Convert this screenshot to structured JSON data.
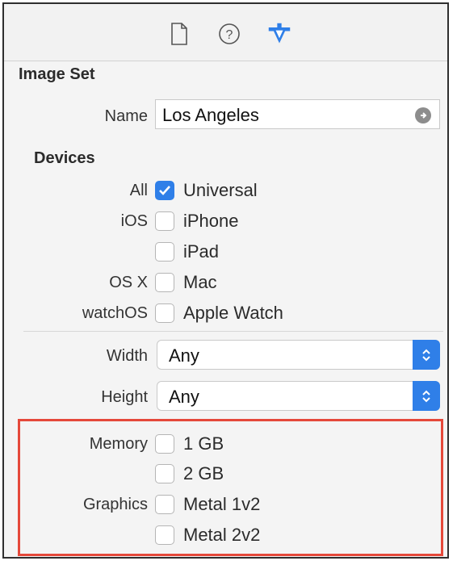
{
  "toolbar": {
    "icons": [
      "file-inspector-icon",
      "quick-help-icon",
      "attributes-inspector-icon"
    ],
    "active_color": "#2f7fe8"
  },
  "image_set": {
    "title": "Image Set",
    "name_label": "Name",
    "name_value": "Los Angeles"
  },
  "devices": {
    "title": "Devices",
    "rows": [
      {
        "label": "All",
        "option": "Universal",
        "checked": true
      },
      {
        "label": "iOS",
        "option": "iPhone",
        "checked": false
      },
      {
        "label": "",
        "option": "iPad",
        "checked": false
      },
      {
        "label": "OS X",
        "option": "Mac",
        "checked": false
      },
      {
        "label": "watchOS",
        "option": "Apple Watch",
        "checked": false
      }
    ]
  },
  "size": {
    "width_label": "Width",
    "width_value": "Any",
    "height_label": "Height",
    "height_value": "Any"
  },
  "requirements": {
    "memory_label": "Memory",
    "memory_options": [
      {
        "option": "1 GB",
        "checked": false
      },
      {
        "option": "2 GB",
        "checked": false
      }
    ],
    "graphics_label": "Graphics",
    "graphics_options": [
      {
        "option": "Metal 1v2",
        "checked": false
      },
      {
        "option": "Metal 2v2",
        "checked": false
      }
    ],
    "highlight_color": "#e5483a"
  }
}
